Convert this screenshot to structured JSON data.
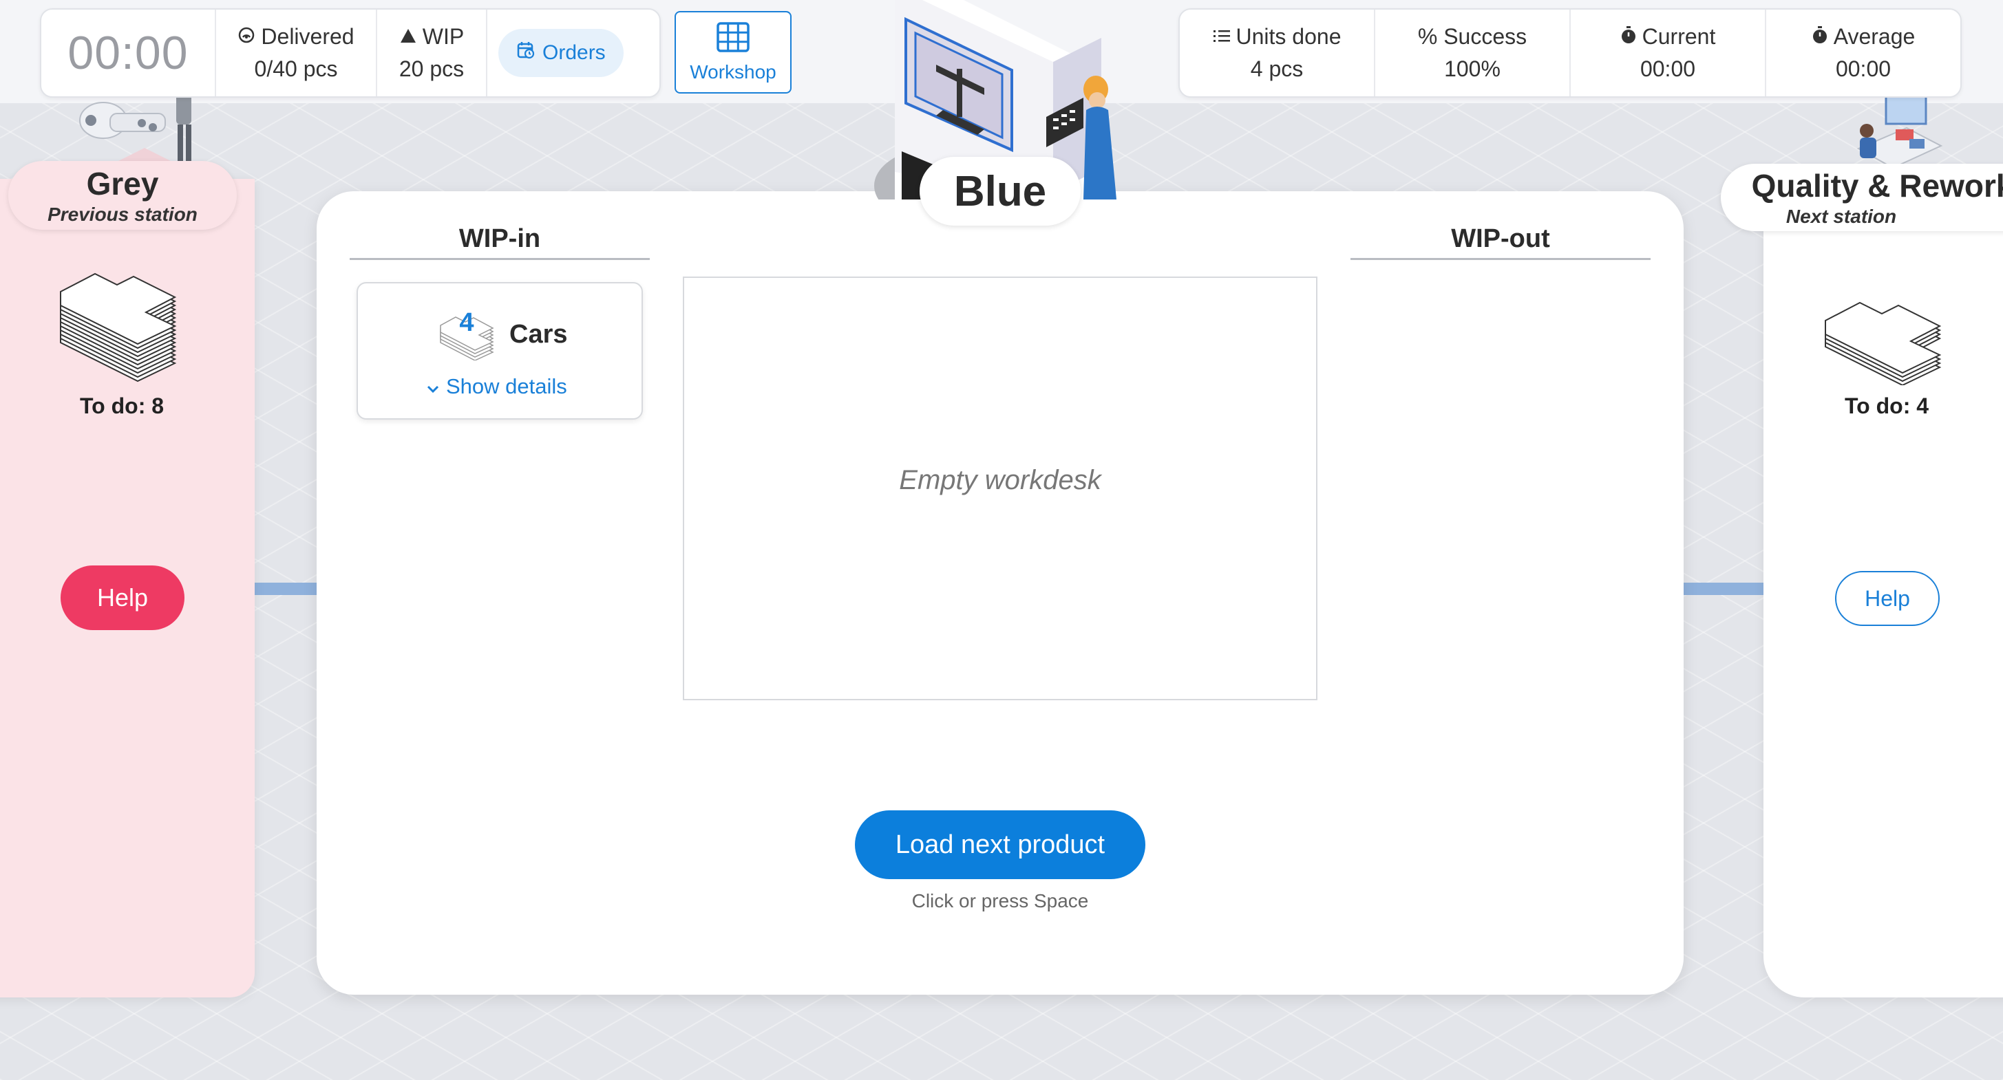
{
  "topbar": {
    "timer": "00:00",
    "delivered": {
      "label": "Delivered",
      "value": "0/40 pcs"
    },
    "wip": {
      "label": "WIP",
      "value": "20 pcs"
    },
    "orders_label": "Orders",
    "workshop_label": "Workshop"
  },
  "stats": {
    "units_done": {
      "label": "Units done",
      "value": "4 pcs"
    },
    "success": {
      "label": "% Success",
      "value": "100%"
    },
    "current": {
      "label": "Current",
      "value": "00:00"
    },
    "average": {
      "label": "Average",
      "value": "00:00"
    }
  },
  "prev_station": {
    "name": "Grey",
    "subtitle": "Previous station",
    "todo": "To do: 8",
    "help_label": "Help"
  },
  "next_station": {
    "name": "Quality & Rework",
    "subtitle": "Next station",
    "todo": "To do: 4",
    "help_label": "Help"
  },
  "main": {
    "station_name": "Blue",
    "wip_in_label": "WIP-in",
    "wip_out_label": "WIP-out",
    "wip_in_item": {
      "count": "4",
      "title": "Cars",
      "details_label": "Show details"
    },
    "workdesk_text": "Empty workdesk",
    "load_button_label": "Load next product",
    "load_hint": "Click or press Space"
  },
  "colors": {
    "accent": "#0c7fdc",
    "help_red": "#ee3a63",
    "prev_panel": "#fbe3e7"
  }
}
